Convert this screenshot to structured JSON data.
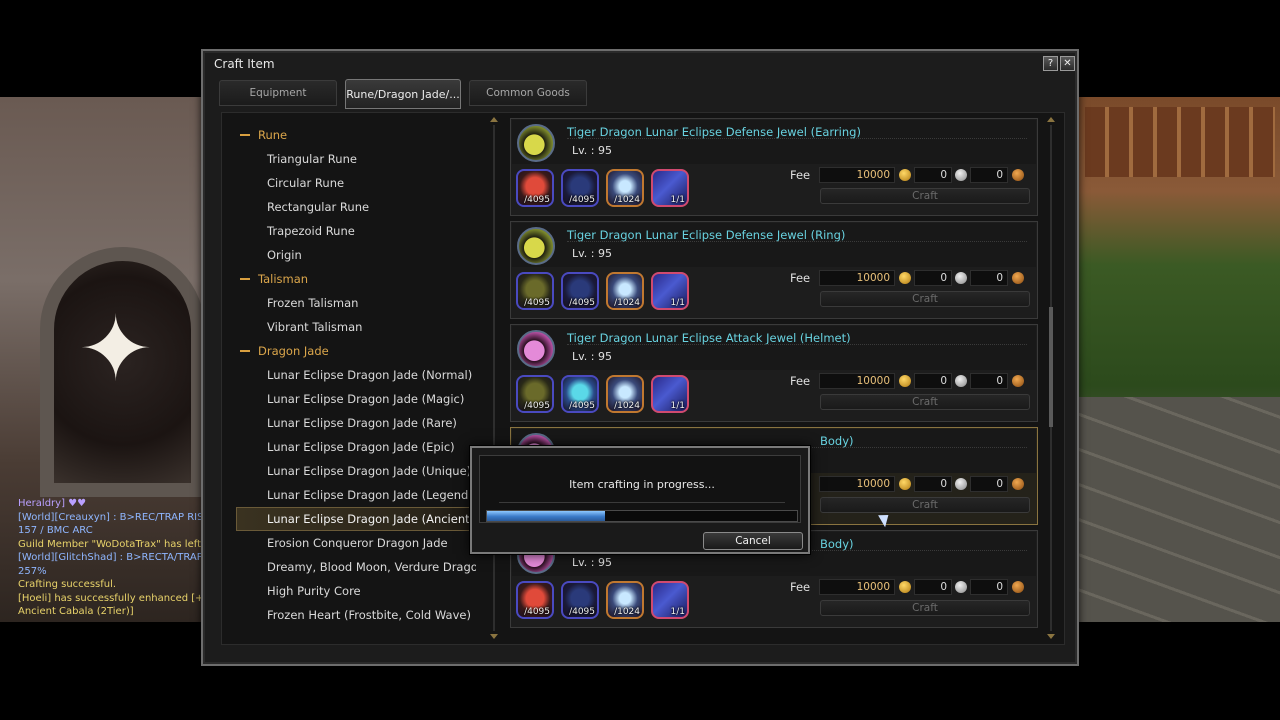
{
  "window": {
    "title": "Craft Item",
    "help_label": "?",
    "close_label": "✕"
  },
  "tabs": [
    {
      "label": "Equipment",
      "active": false
    },
    {
      "label": "Rune/Dragon Jade/...",
      "active": true
    },
    {
      "label": "Common Goods",
      "active": false
    }
  ],
  "categories": {
    "rune": {
      "label": "Rune",
      "items": [
        "Triangular Rune",
        "Circular Rune",
        "Rectangular Rune",
        "Trapezoid Rune",
        "Origin"
      ]
    },
    "talisman": {
      "label": "Talisman",
      "items": [
        "Frozen Talisman",
        "Vibrant Talisman"
      ]
    },
    "dragon_jade": {
      "label": "Dragon Jade",
      "items": [
        "Lunar Eclipse Dragon Jade (Normal)",
        "Lunar Eclipse Dragon Jade (Magic)",
        "Lunar Eclipse Dragon Jade (Rare)",
        "Lunar Eclipse Dragon Jade (Epic)",
        "Lunar Eclipse Dragon Jade (Unique)",
        "Lunar Eclipse Dragon Jade (Legend)",
        "Lunar Eclipse Dragon Jade (Ancient)",
        "Erosion Conqueror Dragon Jade",
        "Dreamy, Blood Moon, Verdure Drago...",
        "High Purity Core",
        "Frozen Heart (Frostbite, Cold Wave)"
      ],
      "selected": "Lunar Eclipse Dragon Jade (Ancient)"
    }
  },
  "recipes": [
    {
      "name": "Tiger Dragon Lunar Eclipse Defense Jewel (Earring)",
      "level": "Lv. : 95",
      "icon": "yellow-moon-icon",
      "materials": [
        "/4095",
        "/4095",
        "/1024",
        "1/1"
      ],
      "fee_label": "Fee",
      "fee_gold": "10000",
      "fee_silver": "0",
      "fee_bronze": "0",
      "craft_label": "Craft"
    },
    {
      "name": "Tiger Dragon Lunar Eclipse Defense Jewel (Ring)",
      "level": "Lv. : 95",
      "icon": "yellow-moon-icon",
      "materials": [
        "/4095",
        "/4095",
        "/1024",
        "1/1"
      ],
      "fee_label": "Fee",
      "fee_gold": "10000",
      "fee_silver": "0",
      "fee_bronze": "0",
      "craft_label": "Craft"
    },
    {
      "name": "Tiger Dragon Lunar Eclipse Attack Jewel (Helmet)",
      "level": "Lv. : 95",
      "icon": "pink-moon-icon",
      "materials": [
        "/4095",
        "/4095",
        "/1024",
        "1/1"
      ],
      "fee_label": "Fee",
      "fee_gold": "10000",
      "fee_silver": "0",
      "fee_bronze": "0",
      "craft_label": "Craft"
    },
    {
      "name": "Body)",
      "level": "",
      "icon": "pink-moon-icon",
      "materials": [],
      "fee_label": "",
      "fee_gold": "10000",
      "fee_silver": "0",
      "fee_bronze": "0",
      "craft_label": "Craft"
    },
    {
      "name": "Body)",
      "level": "Lv. : 95",
      "icon": "pink-moon-icon",
      "materials": [
        "/4095",
        "/4095",
        "/1024",
        "1/1"
      ],
      "fee_label": "Fee",
      "fee_gold": "10000",
      "fee_silver": "0",
      "fee_bronze": "0",
      "craft_label": "Craft"
    }
  ],
  "progress_dialog": {
    "message": "Item crafting in progress...",
    "progress": 0.38,
    "cancel_label": "Cancel"
  },
  "chat": [
    {
      "text": "Heraldry] ♥♥",
      "color": "#b9a0ff"
    },
    {
      "text": "[World][Creauxyn] : B>REC/TRAP RISIN",
      "color": "#8fb6ff"
    },
    {
      "text": "157 / BMC ARC",
      "color": "#8fb6ff"
    },
    {
      "text": "Guild Member \"WoDotaTrax\" has left th",
      "color": "#e8d36a"
    },
    {
      "text": "[World][GlitchShad] : B>RECTA/TRAPE",
      "color": "#8fb6ff"
    },
    {
      "text": "257%",
      "color": "#8fb6ff"
    },
    {
      "text": "Crafting successful.",
      "color": "#e8d36a"
    },
    {
      "text": "[Hoeli] has successfully enhanced [+20 (",
      "color": "#e8d36a"
    },
    {
      "text": "Ancient Cabala (2Tier)]",
      "color": "#e8d36a"
    }
  ]
}
